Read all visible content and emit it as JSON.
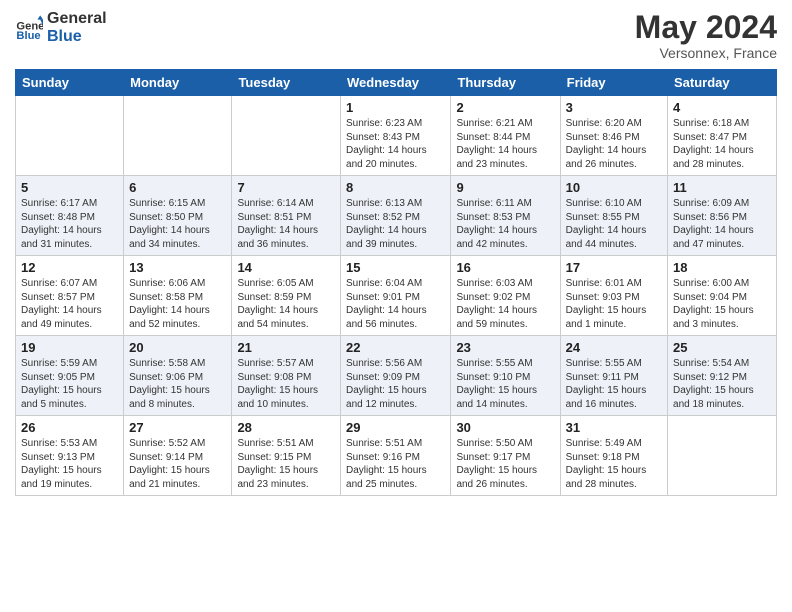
{
  "header": {
    "logo_line1": "General",
    "logo_line2": "Blue",
    "month": "May 2024",
    "location": "Versonnex, France"
  },
  "weekdays": [
    "Sunday",
    "Monday",
    "Tuesday",
    "Wednesday",
    "Thursday",
    "Friday",
    "Saturday"
  ],
  "weeks": [
    [
      {
        "day": "",
        "info": ""
      },
      {
        "day": "",
        "info": ""
      },
      {
        "day": "",
        "info": ""
      },
      {
        "day": "1",
        "info": "Sunrise: 6:23 AM\nSunset: 8:43 PM\nDaylight: 14 hours\nand 20 minutes."
      },
      {
        "day": "2",
        "info": "Sunrise: 6:21 AM\nSunset: 8:44 PM\nDaylight: 14 hours\nand 23 minutes."
      },
      {
        "day": "3",
        "info": "Sunrise: 6:20 AM\nSunset: 8:46 PM\nDaylight: 14 hours\nand 26 minutes."
      },
      {
        "day": "4",
        "info": "Sunrise: 6:18 AM\nSunset: 8:47 PM\nDaylight: 14 hours\nand 28 minutes."
      }
    ],
    [
      {
        "day": "5",
        "info": "Sunrise: 6:17 AM\nSunset: 8:48 PM\nDaylight: 14 hours\nand 31 minutes."
      },
      {
        "day": "6",
        "info": "Sunrise: 6:15 AM\nSunset: 8:50 PM\nDaylight: 14 hours\nand 34 minutes."
      },
      {
        "day": "7",
        "info": "Sunrise: 6:14 AM\nSunset: 8:51 PM\nDaylight: 14 hours\nand 36 minutes."
      },
      {
        "day": "8",
        "info": "Sunrise: 6:13 AM\nSunset: 8:52 PM\nDaylight: 14 hours\nand 39 minutes."
      },
      {
        "day": "9",
        "info": "Sunrise: 6:11 AM\nSunset: 8:53 PM\nDaylight: 14 hours\nand 42 minutes."
      },
      {
        "day": "10",
        "info": "Sunrise: 6:10 AM\nSunset: 8:55 PM\nDaylight: 14 hours\nand 44 minutes."
      },
      {
        "day": "11",
        "info": "Sunrise: 6:09 AM\nSunset: 8:56 PM\nDaylight: 14 hours\nand 47 minutes."
      }
    ],
    [
      {
        "day": "12",
        "info": "Sunrise: 6:07 AM\nSunset: 8:57 PM\nDaylight: 14 hours\nand 49 minutes."
      },
      {
        "day": "13",
        "info": "Sunrise: 6:06 AM\nSunset: 8:58 PM\nDaylight: 14 hours\nand 52 minutes."
      },
      {
        "day": "14",
        "info": "Sunrise: 6:05 AM\nSunset: 8:59 PM\nDaylight: 14 hours\nand 54 minutes."
      },
      {
        "day": "15",
        "info": "Sunrise: 6:04 AM\nSunset: 9:01 PM\nDaylight: 14 hours\nand 56 minutes."
      },
      {
        "day": "16",
        "info": "Sunrise: 6:03 AM\nSunset: 9:02 PM\nDaylight: 14 hours\nand 59 minutes."
      },
      {
        "day": "17",
        "info": "Sunrise: 6:01 AM\nSunset: 9:03 PM\nDaylight: 15 hours\nand 1 minute."
      },
      {
        "day": "18",
        "info": "Sunrise: 6:00 AM\nSunset: 9:04 PM\nDaylight: 15 hours\nand 3 minutes."
      }
    ],
    [
      {
        "day": "19",
        "info": "Sunrise: 5:59 AM\nSunset: 9:05 PM\nDaylight: 15 hours\nand 5 minutes."
      },
      {
        "day": "20",
        "info": "Sunrise: 5:58 AM\nSunset: 9:06 PM\nDaylight: 15 hours\nand 8 minutes."
      },
      {
        "day": "21",
        "info": "Sunrise: 5:57 AM\nSunset: 9:08 PM\nDaylight: 15 hours\nand 10 minutes."
      },
      {
        "day": "22",
        "info": "Sunrise: 5:56 AM\nSunset: 9:09 PM\nDaylight: 15 hours\nand 12 minutes."
      },
      {
        "day": "23",
        "info": "Sunrise: 5:55 AM\nSunset: 9:10 PM\nDaylight: 15 hours\nand 14 minutes."
      },
      {
        "day": "24",
        "info": "Sunrise: 5:55 AM\nSunset: 9:11 PM\nDaylight: 15 hours\nand 16 minutes."
      },
      {
        "day": "25",
        "info": "Sunrise: 5:54 AM\nSunset: 9:12 PM\nDaylight: 15 hours\nand 18 minutes."
      }
    ],
    [
      {
        "day": "26",
        "info": "Sunrise: 5:53 AM\nSunset: 9:13 PM\nDaylight: 15 hours\nand 19 minutes."
      },
      {
        "day": "27",
        "info": "Sunrise: 5:52 AM\nSunset: 9:14 PM\nDaylight: 15 hours\nand 21 minutes."
      },
      {
        "day": "28",
        "info": "Sunrise: 5:51 AM\nSunset: 9:15 PM\nDaylight: 15 hours\nand 23 minutes."
      },
      {
        "day": "29",
        "info": "Sunrise: 5:51 AM\nSunset: 9:16 PM\nDaylight: 15 hours\nand 25 minutes."
      },
      {
        "day": "30",
        "info": "Sunrise: 5:50 AM\nSunset: 9:17 PM\nDaylight: 15 hours\nand 26 minutes."
      },
      {
        "day": "31",
        "info": "Sunrise: 5:49 AM\nSunset: 9:18 PM\nDaylight: 15 hours\nand 28 minutes."
      },
      {
        "day": "",
        "info": ""
      }
    ]
  ]
}
